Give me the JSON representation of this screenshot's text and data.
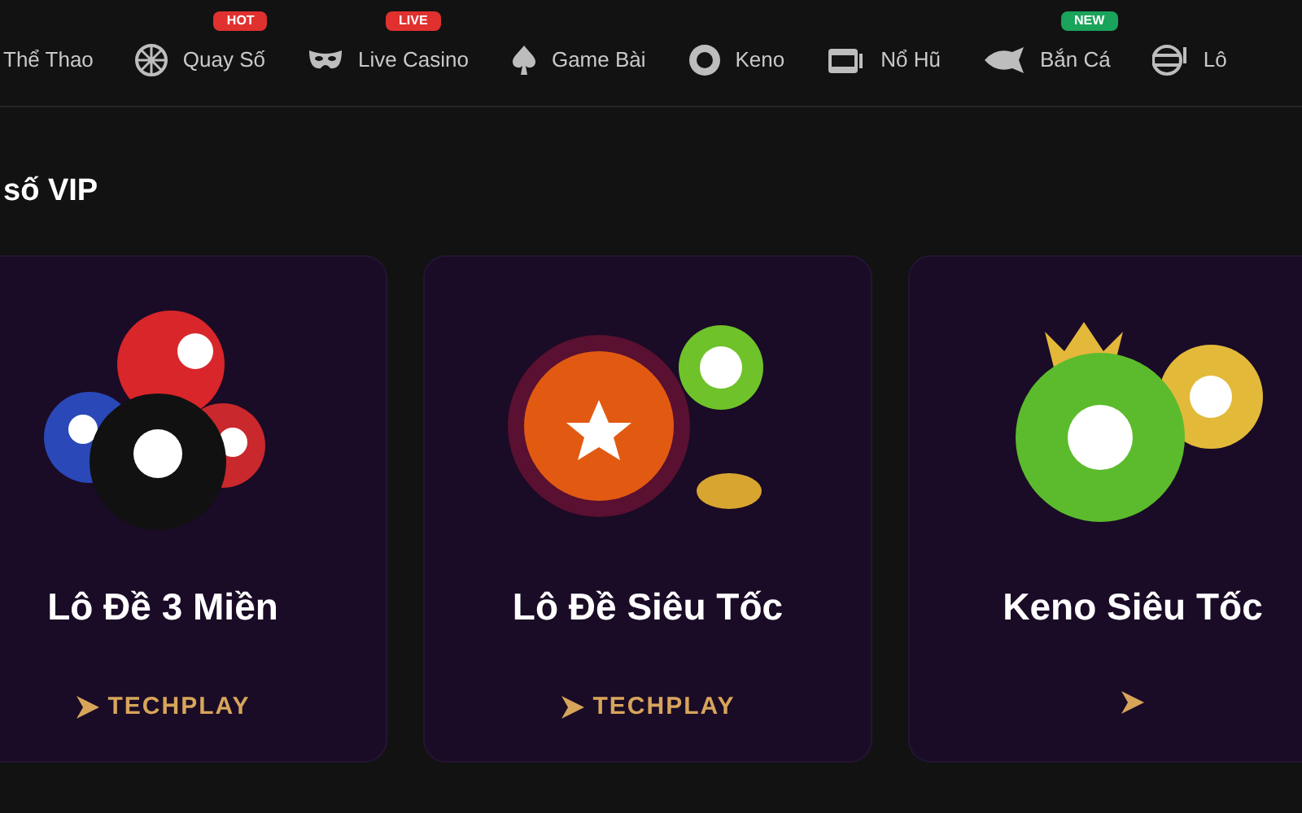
{
  "nav": [
    {
      "label": "Thể Thao",
      "kind": "none"
    },
    {
      "label": "Quay Số",
      "kind": "wheel",
      "badge": "HOT",
      "color": "#e0312f"
    },
    {
      "label": "Live Casino",
      "kind": "mask",
      "badge": "LIVE",
      "color": "#e0312f"
    },
    {
      "label": "Game Bài",
      "kind": "spade"
    },
    {
      "label": "Keno",
      "kind": "ball8"
    },
    {
      "label": "Nổ Hũ",
      "kind": "slot"
    },
    {
      "label": "Bắn Cá",
      "kind": "fish",
      "badge": "NEW",
      "color": "#1aa35a"
    },
    {
      "label": "Lô",
      "kind": "lotto"
    }
  ],
  "section_title": "số VIP",
  "games": [
    {
      "title": "Lô Đề 3 Miền",
      "kind": "pool",
      "provider": "TECHPLAY"
    },
    {
      "title": "Lô Đề Siêu Tốc",
      "kind": "fire",
      "provider": "TECHPLAY"
    },
    {
      "title": "Keno Siêu Tốc",
      "kind": "keno"
    }
  ]
}
